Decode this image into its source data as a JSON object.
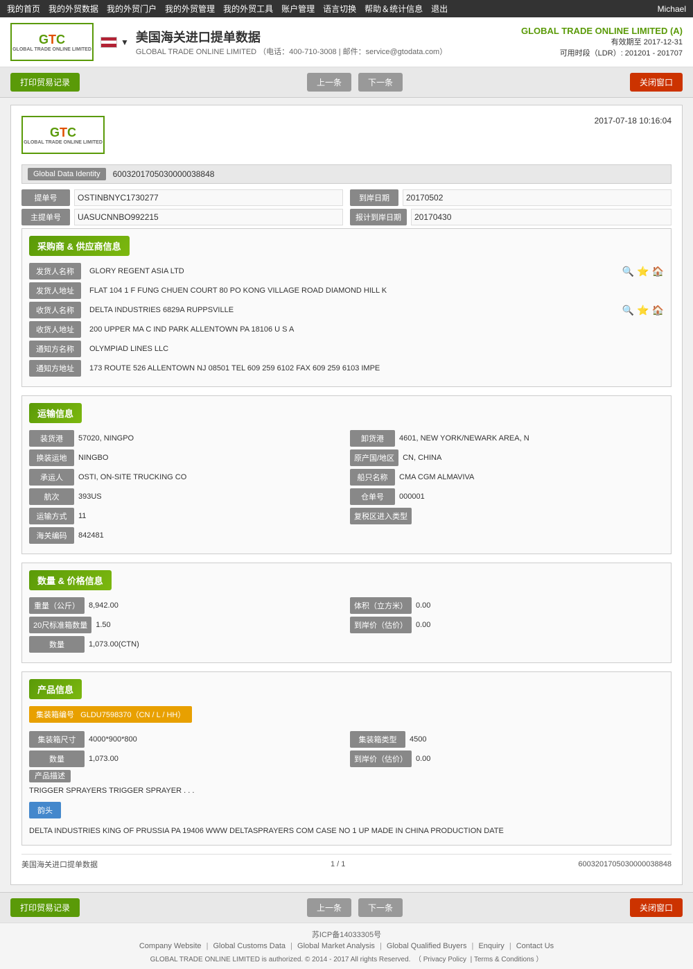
{
  "topnav": {
    "items": [
      "我的首页",
      "我的外贸数据",
      "我的外贸门户",
      "我的外贸管理",
      "我的外贸工具",
      "账户管理",
      "语言切换",
      "帮助＆统计信息",
      "退出"
    ],
    "user": "Michael"
  },
  "header": {
    "logo_text": "GTC",
    "logo_subtitle": "GLOBAL TRADE ONLINE LIMITED",
    "flag_alt": "US Flag",
    "title": "美国海关进口提单数据",
    "contact_phone": "400-710-3008",
    "contact_email": "service@gtodata.com",
    "company": "GLOBAL TRADE ONLINE LIMITED (A)",
    "valid_until": "有效期至 2017-12-31",
    "available_time": "可用时段（LDR）: 201201 - 201707"
  },
  "toolbar": {
    "print_label": "打印贸易记录",
    "prev_label": "上一条",
    "next_label": "下一条",
    "close_label": "关闭窗口"
  },
  "document": {
    "datetime": "2017-07-18  10:16:04",
    "gdi_label": "Global Data Identity",
    "gdi_value": "6003201705030000038848",
    "bill_no_label": "提单号",
    "bill_no_value": "OSTINBNYC1730277",
    "arrival_date_label": "到岸日期",
    "arrival_date_value": "20170502",
    "master_bill_label": "主提单号",
    "master_bill_value": "UASUCNNBO992215",
    "expected_arrival_label": "报计到岸日期",
    "expected_arrival_value": "20170430",
    "supplier_section": "采购商 & 供应商信息",
    "shipper_name_label": "发货人名称",
    "shipper_name_value": "GLORY REGENT ASIA LTD",
    "shipper_address_label": "发货人地址",
    "shipper_address_value": "FLAT 104 1 F FUNG CHUEN COURT 80 PO KONG VILLAGE ROAD DIAMOND HILL K",
    "consignee_name_label": "收货人名称",
    "consignee_name_value": "DELTA INDUSTRIES 6829A RUPPSVILLE",
    "consignee_address_label": "收货人地址",
    "consignee_address_value": "200 UPPER MA C IND PARK ALLENTOWN PA 18106 U S A",
    "notify_name_label": "通知方名称",
    "notify_name_value": "OLYMPIAD LINES LLC",
    "notify_address_label": "通知方地址",
    "notify_address_value": "173 ROUTE 526 ALLENTOWN NJ 08501 TEL 609 259 6102 FAX 609 259 6103 IMPE",
    "transport_section": "运输信息",
    "loading_port_label": "装货港",
    "loading_port_value": "57020, NINGPO",
    "unloading_port_label": "卸货港",
    "unloading_port_value": "4601, NEW YORK/NEWARK AREA, N",
    "transit_label": "换装运地",
    "transit_value": "NINGBO",
    "origin_country_label": "原产国/地区",
    "origin_country_value": "CN, CHINA",
    "carrier_label": "承运人",
    "carrier_value": "OSTI, ON-SITE TRUCKING CO",
    "vessel_label": "船只名称",
    "vessel_value": "CMA CGM ALMAVIVA",
    "voyage_label": "航次",
    "voyage_value": "393US",
    "warehouse_label": "仓单号",
    "warehouse_value": "000001",
    "transport_mode_label": "运输方式",
    "transport_mode_value": "11",
    "bonded_label": "复税区进入类型",
    "customs_label": "海关编码",
    "customs_value": "842481",
    "quantity_section": "数量 & 价格信息",
    "weight_label": "重量（公斤）",
    "weight_value": "8,942.00",
    "volume_label": "体积（立方米）",
    "volume_value": "0.00",
    "container20_label": "20尺标准箱数量",
    "container20_value": "1.50",
    "arrival_price_label": "到岸价（估价）",
    "arrival_price_value": "0.00",
    "quantity_label": "数量",
    "quantity_value": "1,073.00(CTN)",
    "product_section": "产品信息",
    "container_no_label": "集装箱编号",
    "container_no_value": "GLDU7598370（CN / L / HH）",
    "container_size_label": "集装箱尺寸",
    "container_size_value": "4000*900*800",
    "container_type_label": "集装箱类型",
    "container_type_value": "4500",
    "product_qty_label": "数量",
    "product_qty_value": "1,073.00",
    "product_price_label": "到岸价（估价）",
    "product_price_value": "0.00",
    "product_desc_label": "产品描述",
    "product_desc_value": "TRIGGER SPRAYERS TRIGGER SPRAYER . . .",
    "remarks_label": "韵头",
    "remarks_value": "DELTA INDUSTRIES KING OF PRUSSIA PA 19406 WWW DELTASPRAYERS COM CASE NO 1 UP MADE IN CHINA PRODUCTION DATE",
    "footer_source": "美国海关进口提单数据",
    "footer_page": "1 / 1",
    "footer_gdi": "6003201705030000038848"
  },
  "footer": {
    "icp": "苏ICP备14033305号",
    "links": [
      "Company Website",
      "Global Customs Data",
      "Global Market Analysis",
      "Global Qualified Buyers",
      "Enquiry",
      "Contact Us"
    ],
    "copyright": "GLOBAL TRADE ONLINE LIMITED is authorized. © 2014 - 2017 All rights Reserved.",
    "privacy": "Privacy Policy",
    "terms": "Terms & Conditions"
  }
}
